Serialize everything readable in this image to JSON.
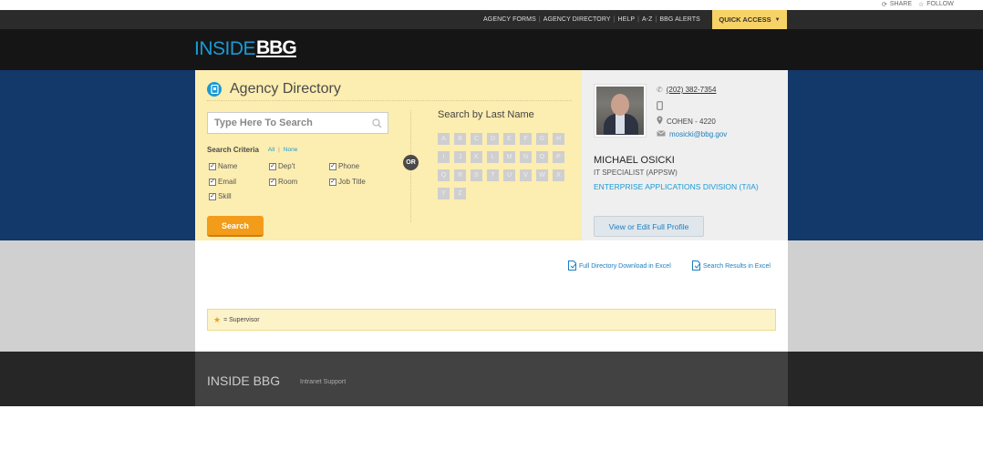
{
  "suite_bar": {
    "share": "SHARE",
    "follow": "FOLLOW"
  },
  "utility_links": [
    "AGENCY FORMS",
    "AGENCY DIRECTORY",
    "HELP",
    "A-Z",
    "BBG ALERTS"
  ],
  "quick_access": "QUICK ACCESS",
  "logo": {
    "inside": "INSIDE",
    "bbg": "BBG"
  },
  "directory": {
    "title": "Agency Directory",
    "search_placeholder": "Type Here To Search",
    "criteria_label": "Search Criteria",
    "all": "All",
    "none": "None",
    "checkboxes": [
      {
        "label": "Name",
        "checked": true
      },
      {
        "label": "Dep't",
        "checked": true
      },
      {
        "label": "Phone",
        "checked": true
      },
      {
        "label": "Email",
        "checked": true
      },
      {
        "label": "Room",
        "checked": true
      },
      {
        "label": "Job Title",
        "checked": true
      },
      {
        "label": "Skill",
        "checked": true
      }
    ],
    "search_button": "Search",
    "or": "OR",
    "last_name_title": "Search by Last Name",
    "letters": [
      "A",
      "B",
      "C",
      "D",
      "E",
      "F",
      "G",
      "H",
      "I",
      "J",
      "K",
      "L",
      "M",
      "N",
      "O",
      "P",
      "Q",
      "R",
      "S",
      "T",
      "U",
      "V",
      "W",
      "X",
      "Y",
      "Z"
    ]
  },
  "profile": {
    "phone": "(202) 382-7354",
    "room": "COHEN - 4220",
    "email": "mosicki@bbg.gov",
    "name": "MICHAEL OSICKI",
    "title": "IT SPECIALIST (APPSW)",
    "division": "ENTERPRISE APPLICATIONS DIVISION (T/IA)",
    "button": "View or Edit Full Profile"
  },
  "downloads": {
    "full": "Full Directory Download in Excel",
    "results": "Search Results in Excel"
  },
  "legend": "= Supervisor",
  "footer": {
    "title": "INSIDE BBG",
    "link": "Intranet Support"
  },
  "colors": {
    "accent": "#1a9ad6",
    "orange": "#f39c1a",
    "panel": "#fcedb0",
    "navy": "#13386a"
  }
}
